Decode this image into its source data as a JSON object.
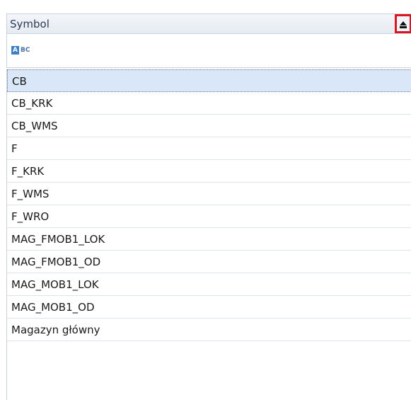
{
  "column": {
    "header_label": "Symbol",
    "sort_direction": "ascending",
    "filter_icon_a": "A",
    "filter_icon_bc": "BC",
    "filter_value": ""
  },
  "rows": [
    {
      "label": "CB",
      "selected": true
    },
    {
      "label": "CB_KRK",
      "selected": false
    },
    {
      "label": "CB_WMS",
      "selected": false
    },
    {
      "label": "F",
      "selected": false
    },
    {
      "label": "F_KRK",
      "selected": false
    },
    {
      "label": "F_WMS",
      "selected": false
    },
    {
      "label": "F_WRO",
      "selected": false
    },
    {
      "label": "MAG_FMOB1_LOK",
      "selected": false
    },
    {
      "label": "MAG_FMOB1_OD",
      "selected": false
    },
    {
      "label": "MAG_MOB1_LOK",
      "selected": false
    },
    {
      "label": "MAG_MOB1_OD",
      "selected": false
    },
    {
      "label": "Magazyn główny",
      "selected": false
    }
  ],
  "colors": {
    "selection": "#d9e7f8",
    "highlight_border": "#e0141e",
    "header_text": "#2a3b55"
  }
}
